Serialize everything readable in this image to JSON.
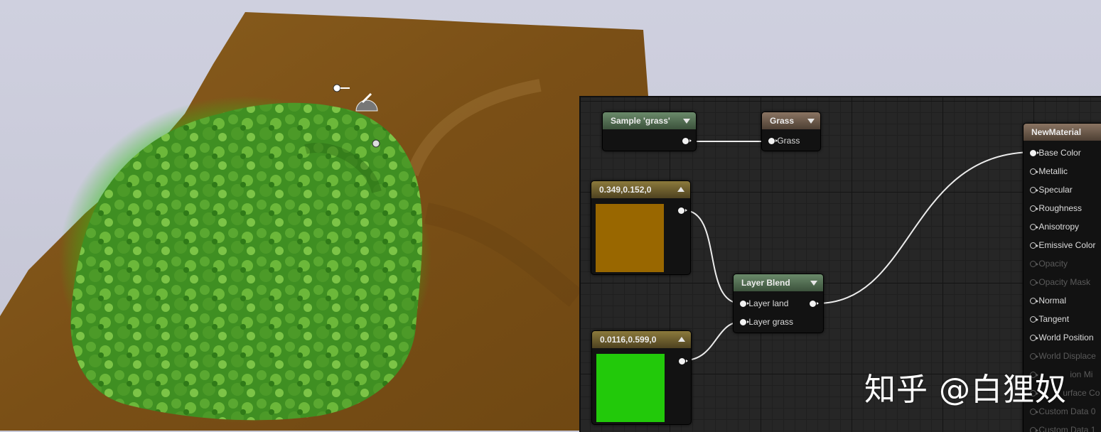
{
  "graph": {
    "sample_node": {
      "title": "Sample 'grass'"
    },
    "grass_node": {
      "title": "Grass",
      "input": "Grass"
    },
    "color_land": {
      "title": "0.349,0.152,0",
      "swatch": "#996700"
    },
    "color_grass": {
      "title": "0.0116,0.599,0",
      "swatch": "#22c90a"
    },
    "layer_blend": {
      "title": "Layer Blend",
      "inputs": [
        "Layer land",
        "Layer grass"
      ]
    },
    "material": {
      "title": "NewMaterial",
      "pins": [
        "Base Color",
        "Metallic",
        "Specular",
        "Roughness",
        "Anisotropy",
        "Emissive Color",
        "Opacity",
        "Opacity Mask",
        "Normal",
        "Tangent",
        "World Position",
        "World Displace",
        "ion Mi",
        "urface Co",
        "Custom Data 0",
        "Custom Data 1"
      ]
    }
  },
  "watermark": "知乎 @白狸奴"
}
